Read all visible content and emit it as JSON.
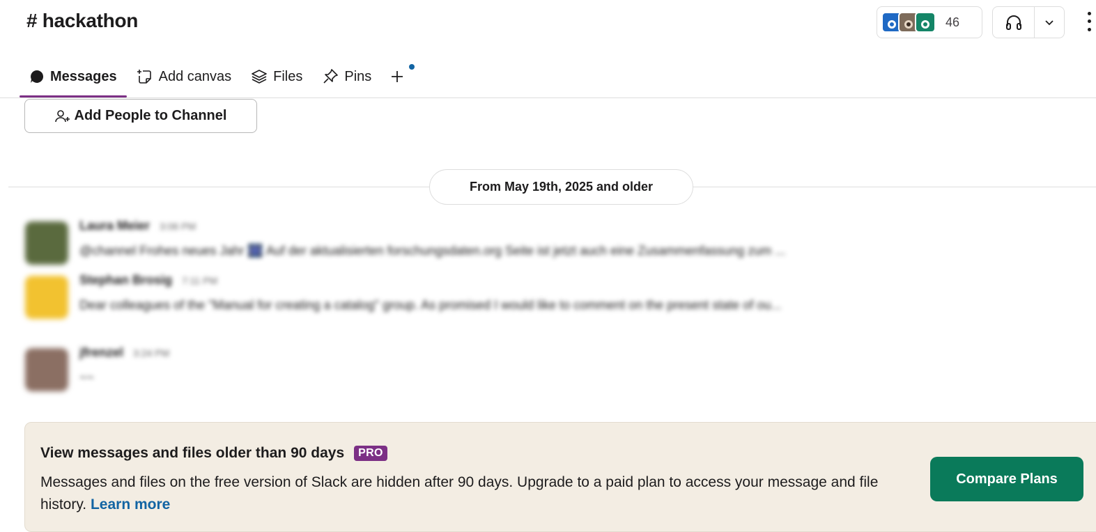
{
  "header": {
    "channel_title": "# hackathon",
    "member_count": "46"
  },
  "tabs": [
    {
      "label": "Messages",
      "icon": "message-bubble-icon",
      "active": true
    },
    {
      "label": "Add canvas",
      "icon": "canvas-add-icon",
      "active": false
    },
    {
      "label": "Files",
      "icon": "layers-icon",
      "active": false
    },
    {
      "label": "Pins",
      "icon": "pin-icon",
      "active": false
    }
  ],
  "add_people": {
    "label": "Add People to Channel"
  },
  "date_divider": {
    "label": "From May 19th, 2025 and older"
  },
  "messages": [
    {
      "author": "Laura Meier",
      "time": "3:06 PM",
      "text": "@channel Frohes neues Jahr 🎆 Auf der aktualisierten forschungsdaten.org Seite ist jetzt auch eine Zusammenfassung zum ...",
      "avatar_color": "#5a6a3e"
    },
    {
      "author": "Stephan Brosig",
      "time": "7:11 PM",
      "text": "Dear colleagues of the \"Manual for creating a catalog\" group. As promised I would like to comment on the present state of ou...",
      "avatar_color": "#f2c230"
    },
    {
      "author": "jfrenzel",
      "time": "3:24 PM",
      "text": "~~",
      "avatar_color": "#8b6f63"
    }
  ],
  "banner": {
    "title": "View messages and files older than 90 days",
    "badge": "PRO",
    "text": "Messages and files on the free version of Slack are hidden after 90 days. Upgrade to a paid plan to access your message and file history.",
    "link": "Learn more",
    "button": "Compare Plans"
  },
  "colors": {
    "accent_purple": "#7c3085",
    "button_green": "#0a7a5a",
    "link_blue": "#1264a3",
    "banner_bg": "#f3ede3"
  }
}
